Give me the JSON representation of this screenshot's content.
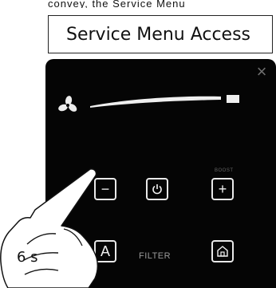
{
  "title": "Service Menu Access",
  "top_text": "convey, the Service Menu",
  "icons": {
    "close": "close-icon",
    "fan": "fan-icon",
    "minus": "minus-icon",
    "power": "power-icon",
    "plus": "plus-icon",
    "mode": "mode-icon",
    "home": "home-icon",
    "hand": "pointing-hand-icon"
  },
  "panel": {
    "close_symbol": "×",
    "minus_symbol": "−",
    "plus_symbol": "+",
    "mode_symbol": "A",
    "boost_label": "BOOST",
    "filter_label": "FILTER"
  },
  "press_time": "6 s",
  "colors": {
    "panel": "#050505",
    "button_stroke": "#e9e9e9",
    "muted_text": "#9a9a9a"
  }
}
